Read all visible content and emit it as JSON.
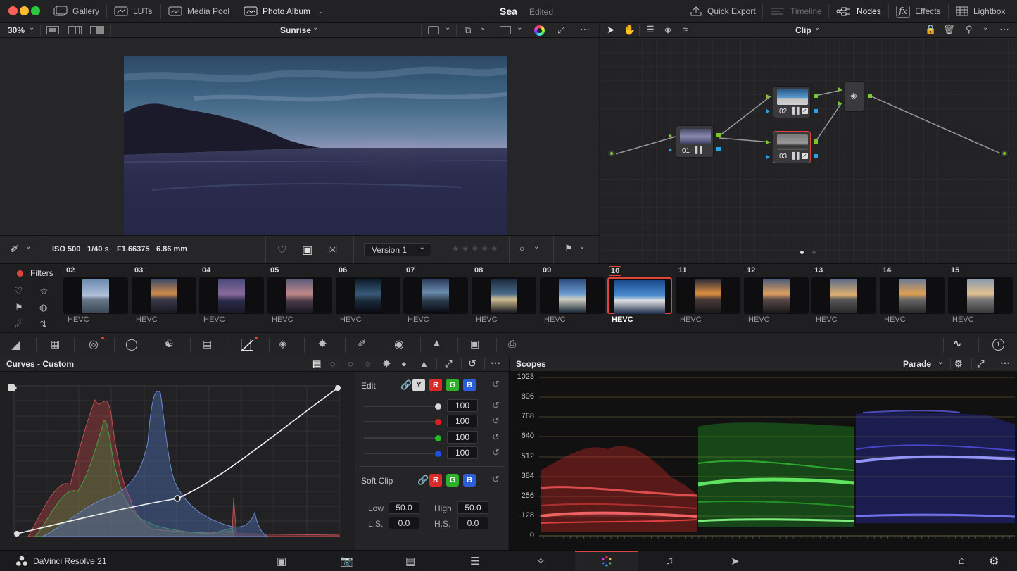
{
  "colors": {
    "accent_red": "#e0453c",
    "green_port": "#7bc828",
    "blue_port": "#29a3e8"
  },
  "topbar": {
    "gallery": "Gallery",
    "luts": "LUTs",
    "media_pool": "Media Pool",
    "photo_album": "Photo Album",
    "project": "Sea",
    "status": "Edited",
    "quick_export": "Quick Export",
    "timeline": "Timeline",
    "nodes": "Nodes",
    "effects": "Effects",
    "lightbox": "Lightbox"
  },
  "viewer": {
    "zoom": "30%",
    "clip_name": "Sunrise",
    "node_mode": "Clip"
  },
  "info": {
    "iso": "ISO 500",
    "shutter": "1/40 s",
    "aperture": "F1.66375",
    "focal": "6.86 mm",
    "version": "Version 1"
  },
  "nodes": [
    {
      "id": "01"
    },
    {
      "id": "02"
    },
    {
      "id": "03"
    }
  ],
  "filters": {
    "label": "Filters"
  },
  "clips": [
    {
      "num": "02",
      "codec": "HEVC"
    },
    {
      "num": "03",
      "codec": "HEVC"
    },
    {
      "num": "04",
      "codec": "HEVC"
    },
    {
      "num": "05",
      "codec": "HEVC"
    },
    {
      "num": "06",
      "codec": "HEVC"
    },
    {
      "num": "07",
      "codec": "HEVC"
    },
    {
      "num": "08",
      "codec": "HEVC"
    },
    {
      "num": "09",
      "codec": "HEVC"
    },
    {
      "num": "10",
      "codec": "HEVC"
    },
    {
      "num": "11",
      "codec": "HEVC"
    },
    {
      "num": "12",
      "codec": "HEVC"
    },
    {
      "num": "13",
      "codec": "HEVC"
    },
    {
      "num": "14",
      "codec": "HEVC"
    },
    {
      "num": "15",
      "codec": "HEVC"
    }
  ],
  "curves": {
    "title": "Curves - Custom"
  },
  "edit": {
    "label": "Edit",
    "y": "Y",
    "r": "R",
    "g": "G",
    "b": "B",
    "values": [
      "100",
      "100",
      "100",
      "100"
    ],
    "soft_clip": "Soft Clip",
    "low_label": "Low",
    "low": "50.0",
    "high_label": "High",
    "high": "50.0",
    "ls_label": "L.S.",
    "ls": "0.0",
    "hs_label": "H.S.",
    "hs": "0.0"
  },
  "scopes": {
    "title": "Scopes",
    "mode": "Parade",
    "ticks": [
      "1023",
      "896",
      "768",
      "640",
      "512",
      "384",
      "256",
      "128",
      "0"
    ]
  },
  "app": {
    "name": "DaVinci Resolve 21"
  }
}
